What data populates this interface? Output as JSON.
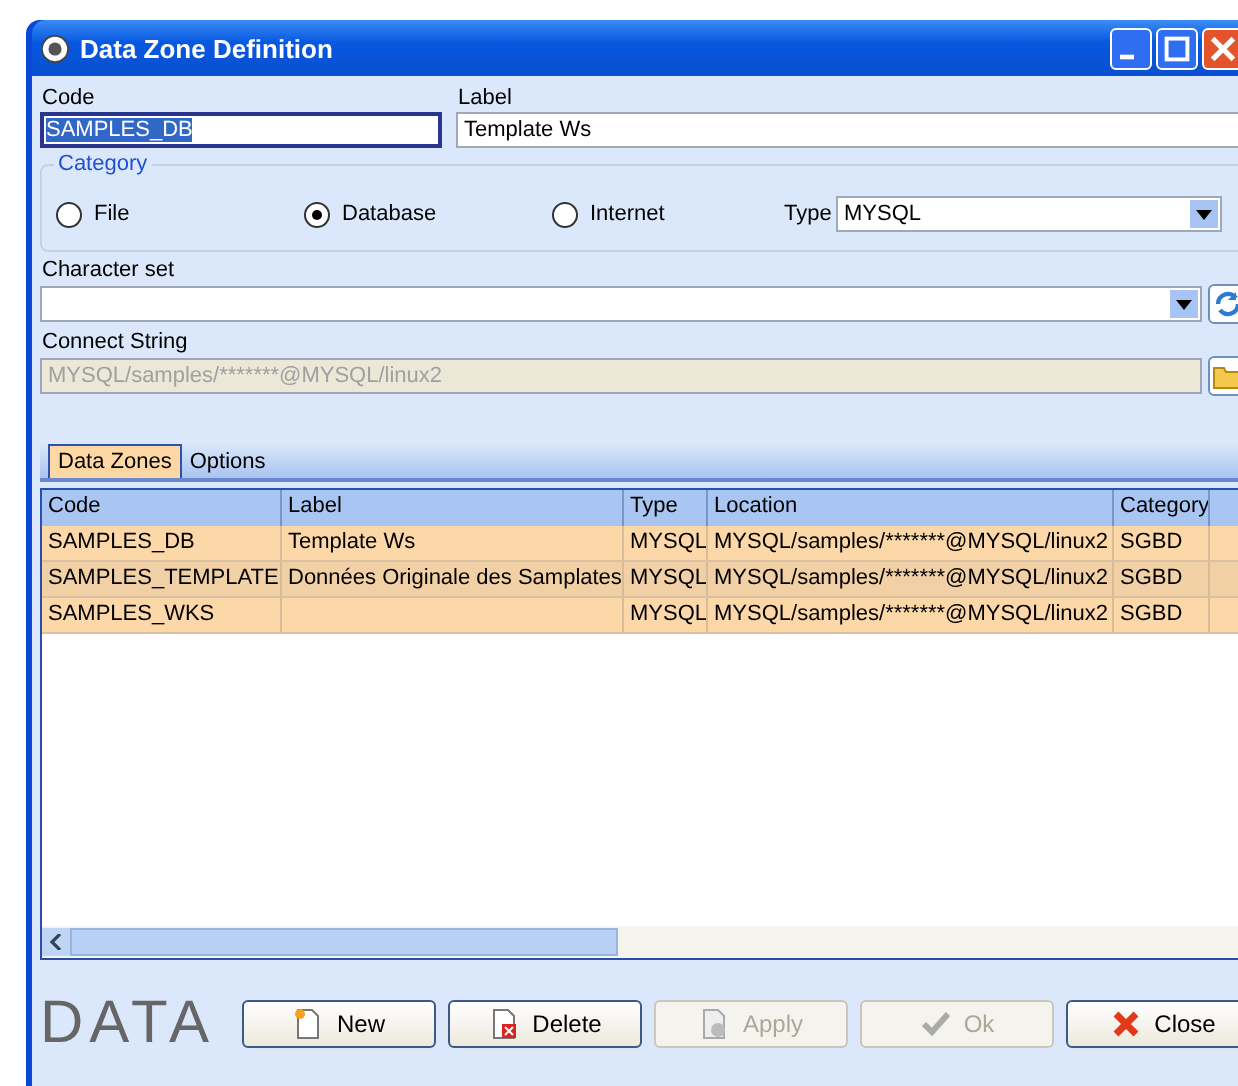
{
  "window": {
    "title": "Data Zone Definition"
  },
  "code": {
    "label": "Code",
    "value": "SAMPLES_DB"
  },
  "label": {
    "label": "Label",
    "value": "Template Ws"
  },
  "category": {
    "title": "Category",
    "options": [
      {
        "label": "File",
        "selected": false
      },
      {
        "label": "Database",
        "selected": true
      },
      {
        "label": "Internet",
        "selected": false
      }
    ],
    "type_label": "Type",
    "type_value": "MYSQL"
  },
  "character_set": {
    "label": "Character set"
  },
  "connect_string": {
    "label": "Connect String",
    "value": "MYSQL/samples/*******@MYSQL/linux2",
    "disabled": true
  },
  "tabs": [
    {
      "label": "Data Zones",
      "selected": true
    },
    {
      "label": "Options",
      "selected": false
    }
  ],
  "table": {
    "columns": [
      "Code",
      "Label",
      "Type",
      "Location",
      "Category"
    ],
    "rows": [
      [
        "SAMPLES_DB",
        "Template Ws",
        "MYSQL",
        "MYSQL/samples/*******@MYSQL/linux2",
        "SGBD"
      ],
      [
        "SAMPLES_TEMPLATE",
        "Données Originale des Samplates",
        "MYSQL",
        "MYSQL/samples/*******@MYSQL/linux2",
        "SGBD"
      ],
      [
        "SAMPLES_WKS",
        "",
        "MYSQL",
        "MYSQL/samples/*******@MYSQL/linux2",
        "SGBD"
      ]
    ]
  },
  "logo": "DATA",
  "buttons": [
    {
      "label": "New",
      "kind": "new",
      "disabled": false
    },
    {
      "label": "Delete",
      "kind": "delete",
      "disabled": false
    },
    {
      "label": "Apply",
      "kind": "apply",
      "disabled": true
    },
    {
      "label": "Ok",
      "kind": "ok",
      "disabled": true
    },
    {
      "label": "Close",
      "kind": "close",
      "disabled": false
    }
  ]
}
